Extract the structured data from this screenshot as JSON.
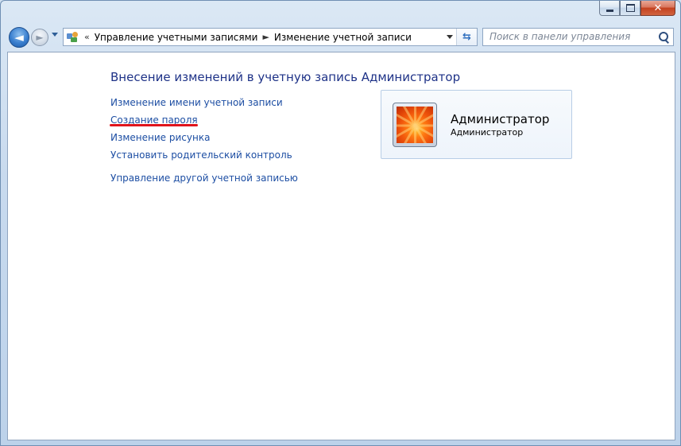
{
  "window": {
    "caption": {
      "minimize_glyph": "",
      "maximize_glyph": "",
      "close_glyph": "✕"
    }
  },
  "nav": {
    "back_glyph": "◄",
    "forward_glyph": "►"
  },
  "address": {
    "overflow_chevron": "«",
    "crumbs": [
      "Управление учетными записями",
      "Изменение учетной записи"
    ],
    "separator": "►"
  },
  "search": {
    "placeholder": "Поиск в панели управления"
  },
  "content": {
    "title": "Внесение изменений в учетную запись Администратор",
    "links": [
      "Изменение имени учетной записи",
      "Создание пароля",
      "Изменение рисунка",
      "Установить родительский контроль",
      "Управление другой учетной записью"
    ]
  },
  "account": {
    "name": "Администратор",
    "type": "Администратор"
  },
  "colors": {
    "link": "#1d4ea3",
    "title": "#1e3287",
    "annotation": "#e0141b"
  }
}
